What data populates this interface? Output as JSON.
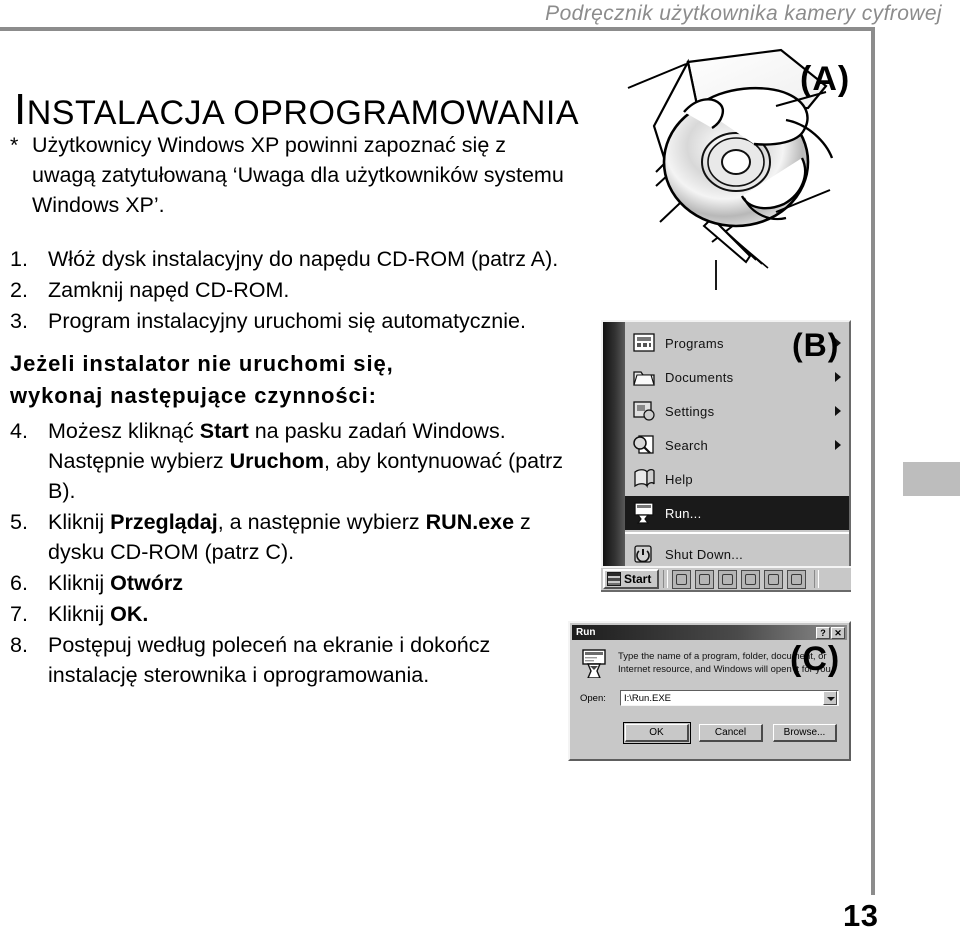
{
  "header": {
    "running_title": "Podręcznik użytkownika kamery cyfrowej"
  },
  "section": {
    "title_initial": "I",
    "title_rest": "NSTALACJA OPROGRAMOWANIA"
  },
  "note": {
    "marker": "*",
    "text": "Użytkownicy Windows XP powinni zapoznać się z uwagą zatytułowaną ‘Uwaga dla użytkowników systemu Windows XP’."
  },
  "steps_before": [
    {
      "num": "1.",
      "text": "Włóż dysk instalacyjny do napędu CD-ROM (patrz A)."
    },
    {
      "num": "2.",
      "text": "Zamknij napęd CD-ROM."
    },
    {
      "num": "3.",
      "text": "Program instalacyjny uruchomi się automatycznie."
    }
  ],
  "emphasis": {
    "line1": "Jeżeli instalator nie uruchomi się,",
    "line2": "wykonaj następujące czynności:"
  },
  "steps_after": [
    {
      "num": "4.",
      "html": "Możesz kliknąć <b>Start</b> na pasku zadań Windows. Następnie wybierz <b>Uruchom</b>, aby kontynuować (patrz B)."
    },
    {
      "num": "5.",
      "html": "Kliknij <b>Przeglądaj</b>, a następnie wybierz <b>RUN.exe</b> z dysku CD-ROM (patrz C)."
    },
    {
      "num": "6.",
      "html": "Kliknij <b>Otwórz</b>"
    },
    {
      "num": "7.",
      "html": "Kliknij <b>OK.</b>"
    },
    {
      "num": "8.",
      "html": "Postępuj według poleceń na ekranie i dokończ instalację sterownika i oprogramowania."
    }
  ],
  "figures": {
    "a": {
      "label": "(A)",
      "caption": "hand inserting CD into open CD-ROM drive tray"
    },
    "b": {
      "label": "(B)"
    },
    "c": {
      "label": "(C)"
    }
  },
  "start_menu": {
    "items": [
      {
        "label": "Programs",
        "icon": "programs-icon",
        "arrow": true,
        "selected": false
      },
      {
        "label": "Documents",
        "icon": "documents-icon",
        "arrow": true,
        "selected": false
      },
      {
        "label": "Settings",
        "icon": "settings-icon",
        "arrow": true,
        "selected": false
      },
      {
        "label": "Search",
        "icon": "search-icon",
        "arrow": true,
        "selected": false
      },
      {
        "label": "Help",
        "icon": "help-icon",
        "arrow": false,
        "selected": false
      },
      {
        "label": "Run...",
        "icon": "run-icon",
        "arrow": false,
        "selected": true
      },
      {
        "label": "Shut Down...",
        "icon": "shutdown-icon",
        "arrow": false,
        "selected": false,
        "separator": true
      }
    ],
    "start_button_label": "Start",
    "tray_icons": [
      "quicklaunch-show-desktop-icon",
      "quicklaunch-channels-icon",
      "quicklaunch-internet-explorer-icon",
      "quicklaunch-outlook-icon",
      "quicklaunch-media-icon",
      "quicklaunch-acrobat-icon"
    ]
  },
  "run_dialog": {
    "title": "Run",
    "help_button": "?",
    "close_button": "✕",
    "description": "Type the name of a program, folder, document, or Internet resource, and Windows will open it for you.",
    "open_label": "Open:",
    "open_value": "I:\\Run.EXE",
    "buttons": [
      {
        "label": "OK",
        "default": true
      },
      {
        "label": "Cancel",
        "default": false
      },
      {
        "label": "Browse...",
        "default": false
      }
    ]
  },
  "page": {
    "number": "13"
  },
  "colors": {
    "rule": "#8c8c8c",
    "header_text": "#8c8c8c",
    "tab": "#bdbdbd",
    "chrome_face": "#c8c8c8",
    "selection": "#1a1a1a"
  }
}
